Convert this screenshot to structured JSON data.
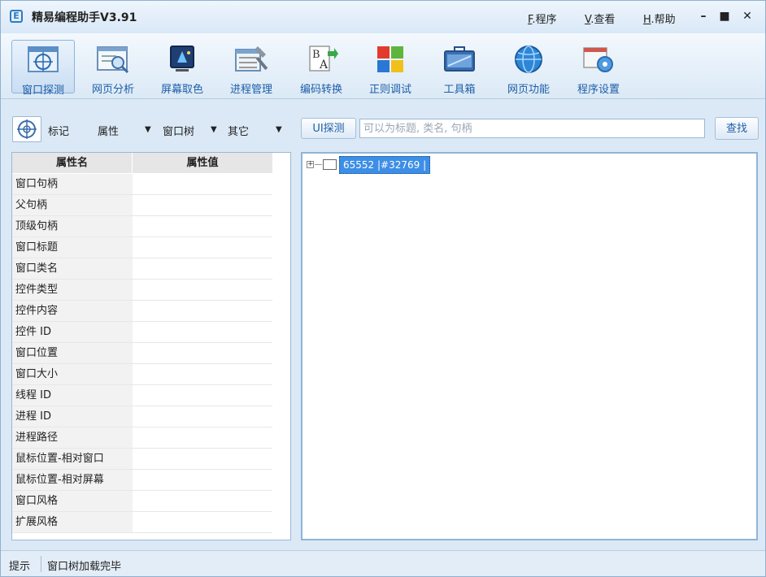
{
  "app": {
    "title": "精易编程助手V3.91"
  },
  "menu": [
    {
      "key": "F",
      "label": ".程序"
    },
    {
      "key": "V",
      "label": ".查看"
    },
    {
      "key": "H",
      "label": ".帮助"
    }
  ],
  "window_controls": {
    "minimize": "–",
    "maximize": "■",
    "close": "✕"
  },
  "toolbar": [
    {
      "label": "窗口探测",
      "icon": "window-probe-icon",
      "active": true
    },
    {
      "label": "网页分析",
      "icon": "web-analysis-icon"
    },
    {
      "label": "屏幕取色",
      "icon": "color-picker-icon"
    },
    {
      "label": "进程管理",
      "icon": "process-manager-icon"
    },
    {
      "label": "编码转换",
      "icon": "encoding-icon"
    },
    {
      "label": "正则调试",
      "icon": "regex-icon"
    },
    {
      "label": "工具箱",
      "icon": "toolbox-icon"
    },
    {
      "label": "网页功能",
      "icon": "globe-icon"
    },
    {
      "label": "程序设置",
      "icon": "settings-icon"
    }
  ],
  "search": {
    "mark_label": "标记",
    "dropdowns": [
      "属性",
      "窗口树",
      "其它"
    ],
    "ui_button": "UI探测",
    "placeholder": "可以为标题, 类名, 句柄",
    "find_button": "查找"
  },
  "properties": {
    "headers": [
      "属性名",
      "属性值"
    ],
    "rows": [
      "窗口句柄",
      "父句柄",
      "顶级句柄",
      "窗口标题",
      "窗口类名",
      "控件类型",
      "控件内容",
      "控件 ID",
      "窗口位置",
      "窗口大小",
      "线程 ID",
      "进程 ID",
      "进程路径",
      "鼠标位置-相对窗口",
      "鼠标位置-相对屏幕",
      "窗口风格",
      "扩展风格"
    ]
  },
  "tree": {
    "root_label": "65552 |#32769 |"
  },
  "status": {
    "label": "提示",
    "message": "窗口树加载完毕"
  },
  "colors": {
    "accent": "#1e5ea8",
    "selection": "#3d8ee6",
    "frame": "#dbe9f6"
  }
}
